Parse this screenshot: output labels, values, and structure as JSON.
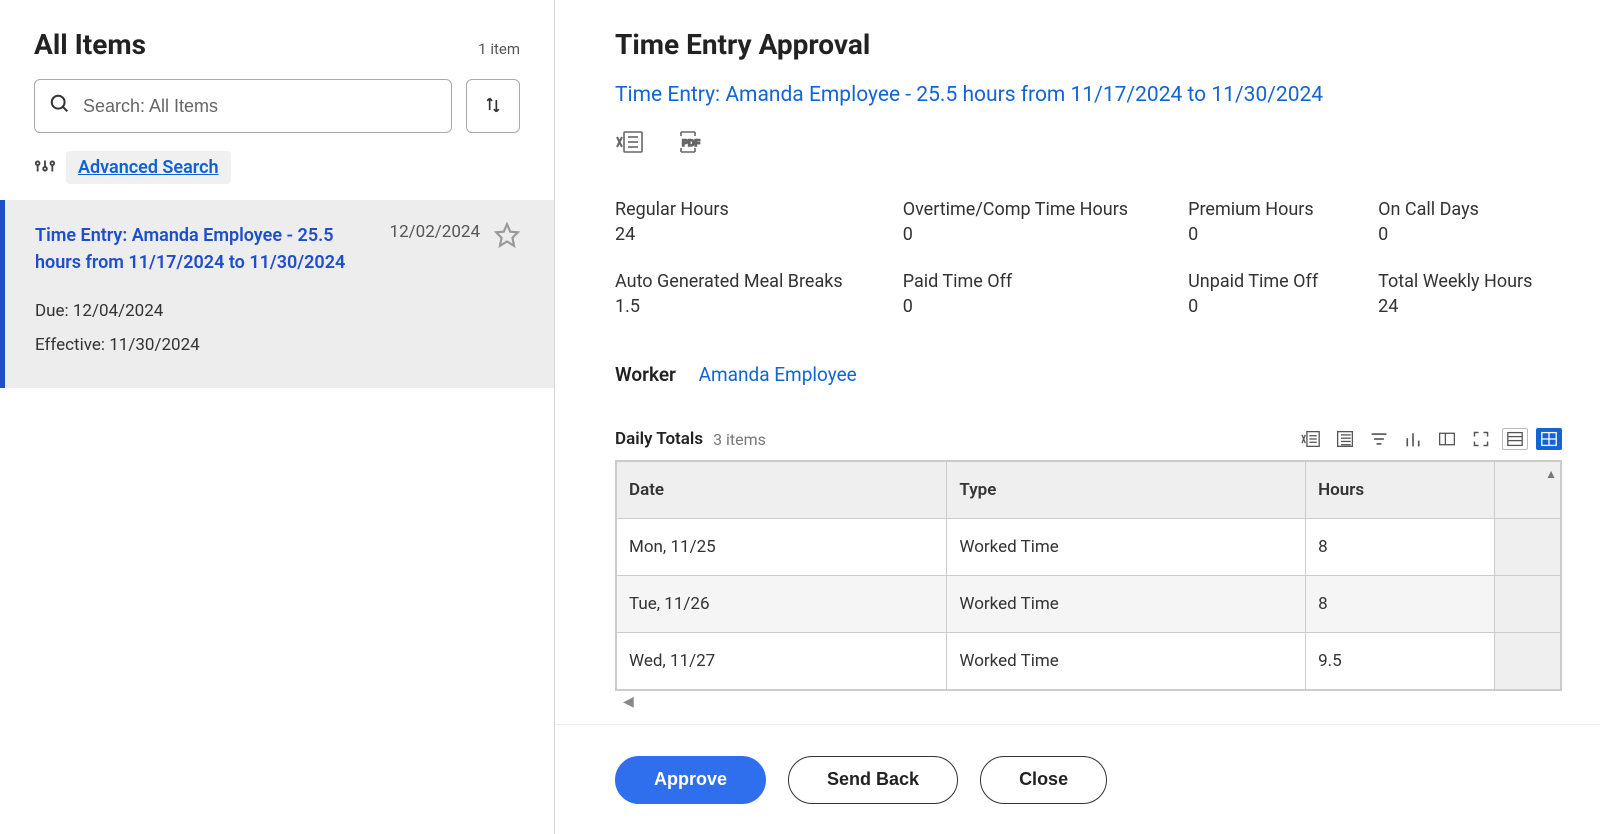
{
  "sidebar": {
    "title": "All Items",
    "item_count": "1 item",
    "search_placeholder": "Search: All Items",
    "advanced_search_label": "Advanced Search",
    "list": [
      {
        "title": "Time Entry: Amanda Employee - 25.5 hours from 11/17/2024 to 11/30/2024",
        "date": "12/02/2024",
        "due": "Due: 12/04/2024",
        "effective": "Effective: 11/30/2024"
      }
    ]
  },
  "main": {
    "title": "Time Entry Approval",
    "subtitle": "Time Entry: Amanda Employee - 25.5 hours from 11/17/2024 to 11/30/2024",
    "summary": [
      {
        "label": "Regular Hours",
        "value": "24"
      },
      {
        "label": "Overtime/Comp Time Hours",
        "value": "0"
      },
      {
        "label": "Premium Hours",
        "value": "0"
      },
      {
        "label": "On Call Days",
        "value": "0"
      },
      {
        "label": "Auto Generated Meal Breaks",
        "value": "1.5"
      },
      {
        "label": "Paid Time Off",
        "value": "0"
      },
      {
        "label": "Unpaid Time Off",
        "value": "0"
      },
      {
        "label": "Total Weekly Hours",
        "value": "24"
      }
    ],
    "worker_label": "Worker",
    "worker_name": "Amanda Employee",
    "table": {
      "title": "Daily Totals",
      "count": "3 items",
      "headers": {
        "date": "Date",
        "type": "Type",
        "hours": "Hours"
      },
      "rows": [
        {
          "date": "Mon, 11/25",
          "type": "Worked Time",
          "hours": "8"
        },
        {
          "date": "Tue, 11/26",
          "type": "Worked Time",
          "hours": "8"
        },
        {
          "date": "Wed, 11/27",
          "type": "Worked Time",
          "hours": "9.5"
        }
      ]
    },
    "buttons": {
      "approve": "Approve",
      "send_back": "Send Back",
      "close": "Close"
    }
  }
}
